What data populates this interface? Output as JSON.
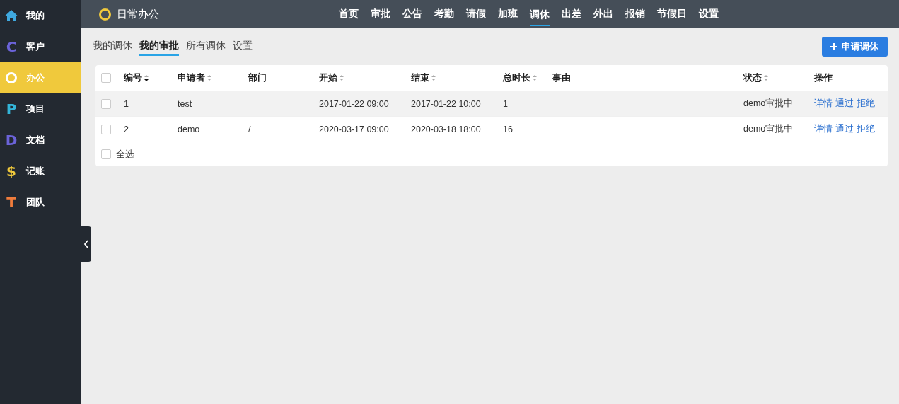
{
  "sidebar": {
    "items": [
      {
        "kind": "home",
        "label": "我的",
        "color": "#3fa9e0",
        "selected": false
      },
      {
        "kind": "letter",
        "glyph": "C",
        "label": "客户",
        "color": "#6b63d9",
        "selected": false
      },
      {
        "kind": "ring",
        "label": "办公",
        "color": "#ffffff",
        "selected": true
      },
      {
        "kind": "letter",
        "glyph": "P",
        "label": "项目",
        "color": "#33b5d9",
        "selected": false
      },
      {
        "kind": "letter",
        "glyph": "D",
        "label": "文档",
        "color": "#6b63d9",
        "selected": false
      },
      {
        "kind": "letter",
        "glyph": "$",
        "label": "记账",
        "color": "#f0c93c",
        "selected": false
      },
      {
        "kind": "letter",
        "glyph": "T",
        "label": "团队",
        "color": "#f07c3c",
        "selected": false
      }
    ]
  },
  "topbar": {
    "title": "日常办公",
    "nav": [
      {
        "label": "首页",
        "selected": false
      },
      {
        "label": "审批",
        "selected": false
      },
      {
        "label": "公告",
        "selected": false
      },
      {
        "label": "考勤",
        "selected": false
      },
      {
        "label": "请假",
        "selected": false
      },
      {
        "label": "加班",
        "selected": false
      },
      {
        "label": "调休",
        "selected": true
      },
      {
        "label": "出差",
        "selected": false
      },
      {
        "label": "外出",
        "selected": false
      },
      {
        "label": "报销",
        "selected": false
      },
      {
        "label": "节假日",
        "selected": false
      },
      {
        "label": "设置",
        "selected": false
      }
    ]
  },
  "tabs": [
    {
      "label": "我的调休",
      "selected": false
    },
    {
      "label": "我的审批",
      "selected": true
    },
    {
      "label": "所有调休",
      "selected": false
    },
    {
      "label": "设置",
      "selected": false
    }
  ],
  "action_button": "申请调休",
  "table": {
    "columns": [
      {
        "label": "编号",
        "sortable": true,
        "sorted_desc": true
      },
      {
        "label": "申请者",
        "sortable": true,
        "sorted_desc": false
      },
      {
        "label": "部门",
        "sortable": false
      },
      {
        "label": "开始",
        "sortable": true,
        "sorted_desc": false
      },
      {
        "label": "结束",
        "sortable": true,
        "sorted_desc": false
      },
      {
        "label": "总时长",
        "sortable": true,
        "sorted_desc": false
      },
      {
        "label": "事由",
        "sortable": false
      },
      {
        "label": "状态",
        "sortable": true,
        "sorted_desc": false
      },
      {
        "label": "操作",
        "sortable": false
      }
    ],
    "header_checked": false,
    "rows": [
      {
        "checked": false,
        "hovered": true,
        "cells": [
          "1",
          "test",
          "",
          "2017-01-22 09:00",
          "2017-01-22 10:00",
          "1",
          "",
          "demo审批中"
        ],
        "actions": [
          "详情",
          "通过",
          "拒绝"
        ]
      },
      {
        "checked": false,
        "hovered": false,
        "cells": [
          "2",
          "demo",
          "/",
          "2020-03-17 09:00",
          "2020-03-18 18:00",
          "16",
          "",
          "demo审批中"
        ],
        "actions": [
          "详情",
          "通过",
          "拒绝"
        ]
      }
    ],
    "select_all": {
      "label": "全选",
      "checked": false
    }
  }
}
